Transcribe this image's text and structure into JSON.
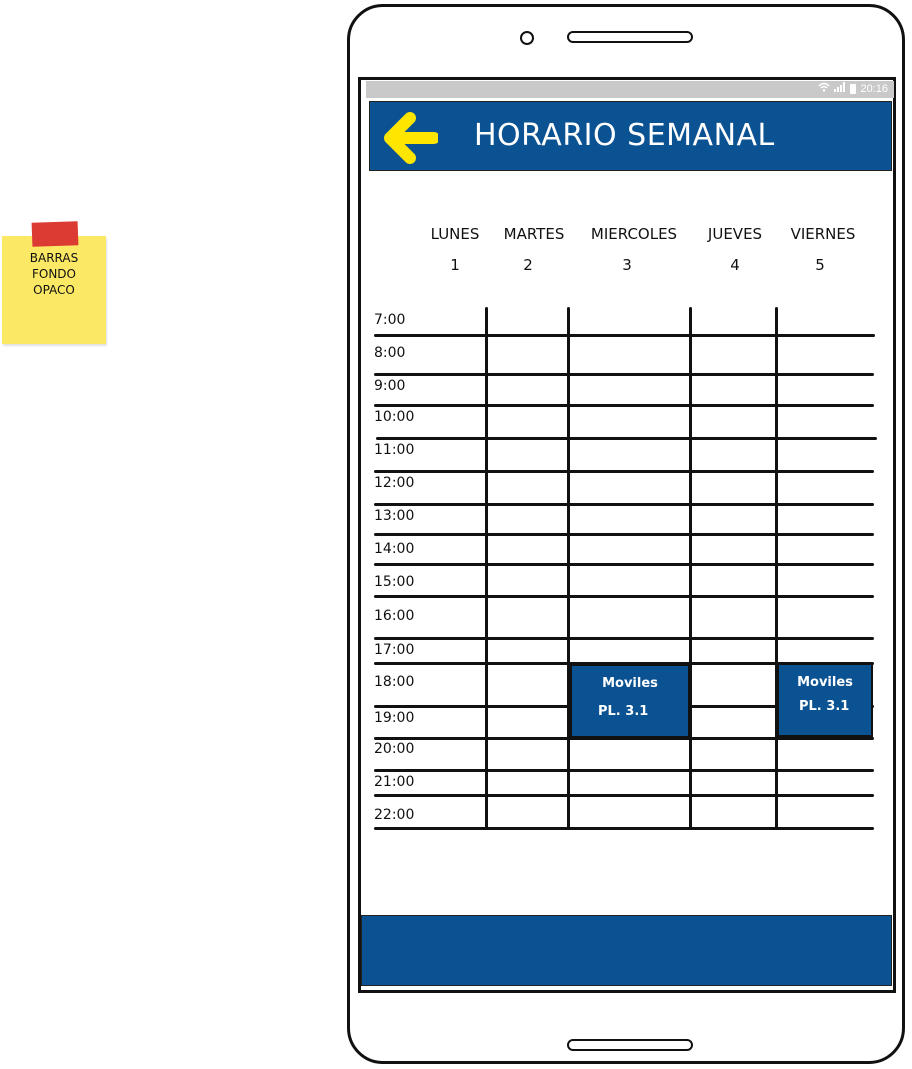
{
  "note": {
    "text": "BARRAS\nFONDO\nOPACO",
    "color": "#fbe965",
    "tape_color": "#db3b32"
  },
  "status_bar": {
    "time": "20:16",
    "icons": [
      "wifi-icon",
      "signal-icon",
      "battery-icon"
    ]
  },
  "app_bar": {
    "title": "HORARIO SEMANAL",
    "back_icon": "arrow-left-icon",
    "back_icon_color": "#ffe600",
    "color": "#0b5292"
  },
  "schedule": {
    "days": [
      {
        "name": "LUNES",
        "number": "1"
      },
      {
        "name": "MARTES",
        "number": "2"
      },
      {
        "name": "MIERCOLES",
        "number": "3"
      },
      {
        "name": "JUEVES",
        "number": "4"
      },
      {
        "name": "VIERNES",
        "number": "5"
      }
    ],
    "hours": [
      "7:00",
      "8:00",
      "9:00",
      "10:00",
      "11:00",
      "12:00",
      "13:00",
      "14:00",
      "15:00",
      "16:00",
      "17:00",
      "18:00",
      "19:00",
      "20:00",
      "21:00",
      "22:00"
    ],
    "events": [
      {
        "day": "MIERCOLES",
        "title": "Moviles",
        "place": "PL. 3.1"
      },
      {
        "day": "VIERNES",
        "title": "Moviles",
        "place": "PL. 3.1"
      }
    ]
  },
  "bottom_bar": {
    "color": "#0b5292"
  }
}
